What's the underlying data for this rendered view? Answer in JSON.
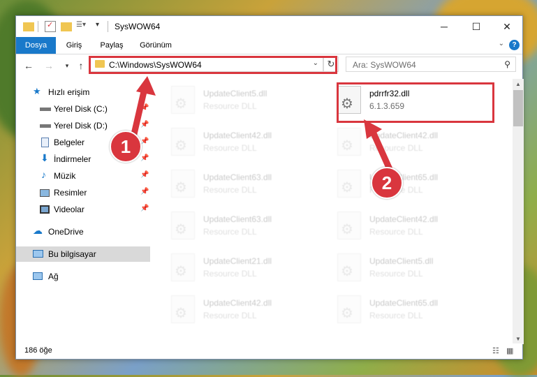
{
  "window": {
    "title": "SysWOW64"
  },
  "ribbon": {
    "tabs": [
      "Dosya",
      "Giriş",
      "Paylaş",
      "Görünüm"
    ]
  },
  "navbar": {
    "address": "C:\\Windows\\SysWOW64",
    "search_placeholder": "Ara: SysWOW64"
  },
  "sidebar": {
    "items": [
      {
        "label": "Hızlı erişim",
        "icon": "star-icon",
        "pinned": false
      },
      {
        "label": "Yerel Disk (C:)",
        "icon": "drive-icon",
        "pinned": true
      },
      {
        "label": "Yerel Disk (D:)",
        "icon": "drive-icon",
        "pinned": true
      },
      {
        "label": "Belgeler",
        "icon": "documents-icon",
        "pinned": true
      },
      {
        "label": "İndirmeler",
        "icon": "download-icon",
        "pinned": true
      },
      {
        "label": "Müzik",
        "icon": "music-icon",
        "pinned": true
      },
      {
        "label": "Resimler",
        "icon": "pictures-icon",
        "pinned": true
      },
      {
        "label": "Videolar",
        "icon": "videos-icon",
        "pinned": true
      },
      {
        "label": "OneDrive",
        "icon": "cloud-icon",
        "pinned": false
      },
      {
        "label": "Bu bilgisayar",
        "icon": "computer-icon",
        "pinned": false
      },
      {
        "label": "Ağ",
        "icon": "network-icon",
        "pinned": false
      }
    ]
  },
  "files": {
    "left": [
      {
        "name": "UpdateClient5.dll",
        "desc": "Resource DLL"
      },
      {
        "name": "UpdateClient42.dll",
        "desc": "Resource DLL"
      },
      {
        "name": "UpdateClient63.dll",
        "desc": "Resource DLL"
      },
      {
        "name": "UpdateClient63.dll",
        "desc": "Resource DLL"
      },
      {
        "name": "UpdateClient21.dll",
        "desc": "Resource DLL"
      },
      {
        "name": "UpdateClient42.dll",
        "desc": "Resource DLL"
      }
    ],
    "right": [
      {
        "name": "pdrrfr32.dll",
        "desc": "6.1.3.659"
      },
      {
        "name": "UpdateClient42.dll",
        "desc": "Resource DLL"
      },
      {
        "name": "UpdateClient65.dll",
        "desc": "Resource DLL"
      },
      {
        "name": "UpdateClient42.dll",
        "desc": "Resource DLL"
      },
      {
        "name": "UpdateClient5.dll",
        "desc": "Resource DLL"
      },
      {
        "name": "UpdateClient65.dll",
        "desc": "Resource DLL"
      }
    ]
  },
  "status": {
    "count": "186 öğe"
  },
  "annotations": {
    "badge1": "1",
    "badge2": "2"
  },
  "colors": {
    "accent": "#1979ca",
    "highlight": "#d9363e",
    "folder": "#f0c652"
  }
}
